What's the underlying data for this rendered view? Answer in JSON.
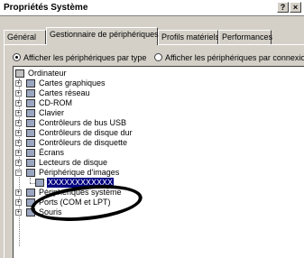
{
  "window": {
    "title": "Propriétés Système",
    "help_button": "?",
    "close_button": "×"
  },
  "tabs": [
    {
      "label": "Général"
    },
    {
      "label": "Gestionnaire de périphériques",
      "active": true
    },
    {
      "label": "Profils matériels"
    },
    {
      "label": "Performances"
    }
  ],
  "view_options": {
    "by_type": "Afficher les périphériques par type",
    "by_connection": "Afficher les périphériques par connexion",
    "selected": "by_type"
  },
  "tree": {
    "root": "Ordinateur",
    "items": [
      {
        "label": "Cartes graphiques",
        "icon": "display-adapter-icon"
      },
      {
        "label": "Cartes réseau",
        "icon": "network-card-icon"
      },
      {
        "label": "CD-ROM",
        "icon": "cdrom-icon"
      },
      {
        "label": "Clavier",
        "icon": "keyboard-icon"
      },
      {
        "label": "Contrôleurs de bus USB",
        "icon": "usb-icon"
      },
      {
        "label": "Contrôleurs de disque dur",
        "icon": "hard-disk-controller-icon"
      },
      {
        "label": "Contrôleurs de disquette",
        "icon": "floppy-controller-icon"
      },
      {
        "label": "Écrans",
        "icon": "monitor-icon"
      },
      {
        "label": "Lecteurs de disque",
        "icon": "disk-drive-icon"
      },
      {
        "label": "Périphérique d'images",
        "icon": "imaging-device-icon",
        "expanded": true
      },
      {
        "label": "XXXXXXXXXXXX",
        "icon": "scanner-icon",
        "child": true,
        "selected": true
      },
      {
        "label": "Périphériques système",
        "icon": "system-devices-icon"
      },
      {
        "label": "Ports (COM et LPT)",
        "icon": "ports-icon"
      },
      {
        "label": "Souris",
        "icon": "mouse-icon"
      }
    ]
  },
  "colors": {
    "selection": "#000080",
    "face": "#d4d0c8",
    "highlight_ellipse": "#000000"
  }
}
